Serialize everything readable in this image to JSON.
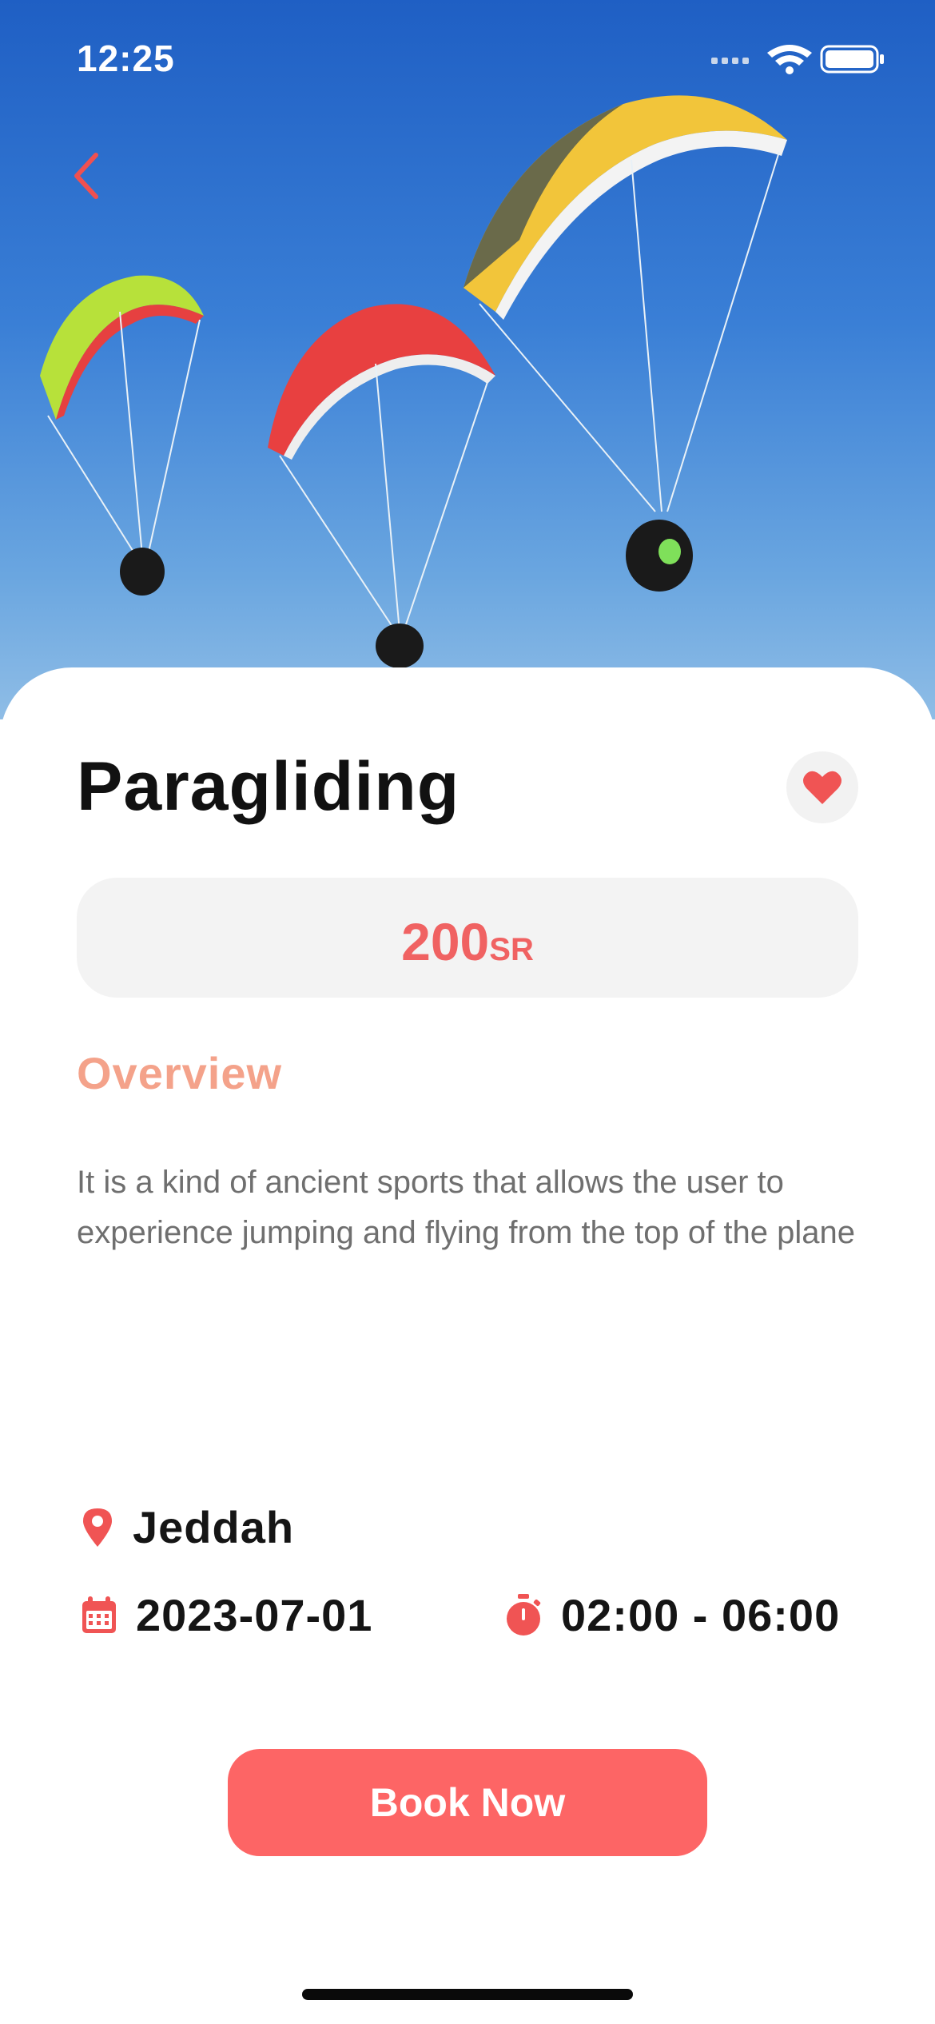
{
  "status_bar": {
    "time": "12:25"
  },
  "hero": {
    "image_subject": "paragliders-photo"
  },
  "activity": {
    "title": "Paragliding",
    "price_value": "200",
    "price_currency": "SR",
    "overview_heading": "Overview",
    "description": "It is a kind of ancient sports that allows the user to experience jumping and flying from the top of the plane",
    "location": "Jeddah",
    "date": "2023-07-01",
    "time_range": "02:00 - 06:00"
  },
  "actions": {
    "book_label": "Book Now"
  },
  "colors": {
    "accent": "#fd6565",
    "price": "#f06262",
    "overview": "#f4a28a",
    "price_bg": "#f3f3f3"
  },
  "icons": {
    "back": "chevron-left-icon",
    "favorite": "heart-icon",
    "location": "location-pin-icon",
    "date": "calendar-icon",
    "time": "stopwatch-icon"
  }
}
